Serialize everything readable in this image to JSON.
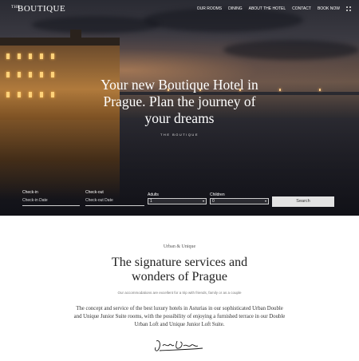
{
  "brand": {
    "the": "THE",
    "name": "BOUTIQUE"
  },
  "nav": {
    "items": [
      "OUR ROOMS",
      "DINING",
      "ABOUT THE HOTEL",
      "CONTACT",
      "BOOK NOW"
    ],
    "icon": "grid-menu-icon"
  },
  "hero": {
    "title_line1": "Your new Boutique Hotel in",
    "title_line2": "Prague. Plan the journey of",
    "title_line3": "your dreams",
    "subtitle": "THE BOUTIQUE"
  },
  "booking": {
    "checkin_label": "Check-in",
    "checkin_placeholder": "Check-in Date",
    "checkout_label": "Check-out",
    "checkout_placeholder": "Check-out Date",
    "adults_label": "Adults",
    "adults_value": "1",
    "children_label": "Children",
    "children_value": "0",
    "search_label": "Search"
  },
  "section": {
    "eyebrow": "Urban & Unique",
    "title_line1": "The signature services and",
    "title_line2": "wonders of Prague",
    "small_text": "Our accommodations are excellent for a trip with friends, family or as a couple",
    "body": "The concept and service of the best luxury hotels in Asturias in our sophisticated Urban Double and Unique Junior Suite rooms, with the possibility of enjoying a furnished terrace in our Double Urban Loft and Unique Junior Loft Suite."
  },
  "colors": {
    "accent": "#e3e3e3",
    "text_dark": "#222222"
  }
}
